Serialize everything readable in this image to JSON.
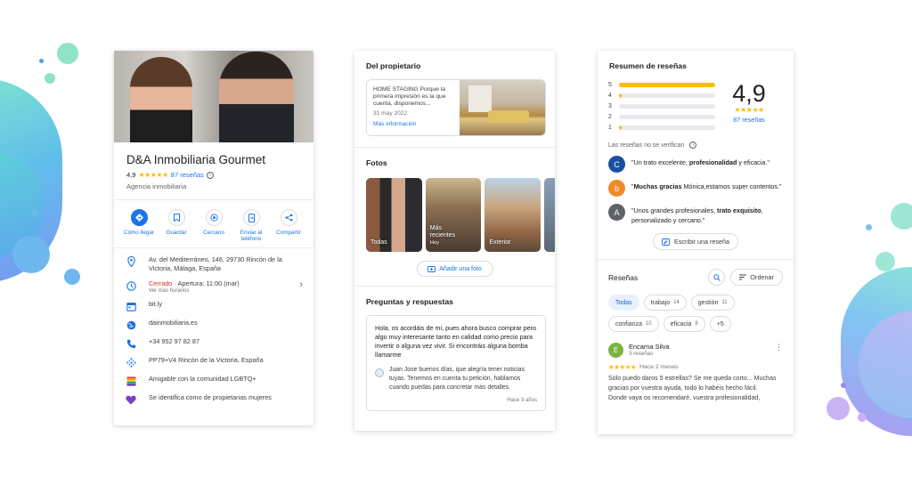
{
  "colors": {
    "accent": "#1a73e8",
    "star": "#fbbc04",
    "closed": "#d93025"
  },
  "profile": {
    "name": "D&A Inmobiliaria Gourmet",
    "rating": "4,9",
    "stars": "★★★★★",
    "reviews_link": "87 reseñas",
    "category": "Agencia inmobiliaria",
    "actions": [
      {
        "label": "Cómo llegar",
        "icon": "directions-icon"
      },
      {
        "label": "Guardar",
        "icon": "bookmark-icon"
      },
      {
        "label": "Cercano",
        "icon": "nearby-icon"
      },
      {
        "label": "Enviar al teléfono",
        "icon": "send-to-phone-icon"
      },
      {
        "label": "Compartir",
        "icon": "share-icon"
      }
    ],
    "address": "Av. del Mediterráneo, 146, 29730 Rincón de la Victoria, Málaga, España",
    "hours_status": "Cerrado",
    "hours_open": " · Apertura: 11:00 (mar)",
    "hours_more": "Ver más horarios",
    "menu_link": "bit.ly",
    "website": "dainmobiliaria.es",
    "phone": "+34 952 97 82 87",
    "plus_code": "PP79+V4 Rincón de la Victoria, España",
    "lgbtq": "Amigable con la comunidad LGBTQ+",
    "women_owned": "Se identifica como de propietarias mujeres"
  },
  "owner": {
    "title": "Del propietario",
    "post_text": "HOME STAGING Porque la primera impresión es la que cuenta, disponemos...",
    "post_date": "31 may 2022",
    "post_more": "Más información"
  },
  "photos": {
    "title": "Fotos",
    "items": [
      {
        "label": "Todas",
        "sub": ""
      },
      {
        "label": "Más recientes",
        "sub": "Hoy"
      },
      {
        "label": "Exterior",
        "sub": ""
      }
    ],
    "add_label": "Añadir una foto"
  },
  "qa": {
    "title": "Preguntas y respuestas",
    "question": "Hola, os acordáis de mi, pues ahora busco comprar pero algo muy interesante tanto en calidad como precio para invertir o alguna vez vivir. Si encontráis alguna bomba llamarme",
    "answer": "Juan Jose buenos días, que alegría tener noticias tuyas. Tenemos en cuenta tu petición, hablamos cuando puedas para concretar más detalles.",
    "time": "Hace 3 años"
  },
  "summary": {
    "title": "Resumen de reseñas",
    "distribution": [
      {
        "star": "5",
        "fraction": 1.0
      },
      {
        "star": "4",
        "fraction": 0.03
      },
      {
        "star": "3",
        "fraction": 0.0
      },
      {
        "star": "2",
        "fraction": 0.0
      },
      {
        "star": "1",
        "fraction": 0.03
      }
    ],
    "score": "4,9",
    "stars": "★★★★★",
    "count": "87 reseñas",
    "not_verified": "Las reseñas no se verifican",
    "quotes": [
      {
        "initial": "C",
        "color": "#1a4fa0",
        "pre": "\"Un trato excelente, ",
        "bold": "profesionalidad",
        "post": " y eficacia.\""
      },
      {
        "initial": "b",
        "color": "#ef8a2b",
        "pre": "\"",
        "bold": "Muchas gracias",
        "post": " Mónica,estamos super contentos.\""
      },
      {
        "initial": "A",
        "color": "#5f6368",
        "pre": "\"Unos grandes profesionales, ",
        "bold": "trato exquisito",
        "post": ", personalizado y cercano.\""
      }
    ],
    "write_review": "Escribir una reseña"
  },
  "reviews": {
    "title": "Reseñas",
    "sort_label": "Ordenar",
    "chips": [
      {
        "label": "Todas",
        "count": ""
      },
      {
        "label": "trabajo",
        "count": "14"
      },
      {
        "label": "gestión",
        "count": "11"
      },
      {
        "label": "confianza",
        "count": "10"
      },
      {
        "label": "eficacia",
        "count": "8"
      },
      {
        "label": "+5",
        "count": ""
      }
    ],
    "first": {
      "initial": "E",
      "name": "Encarna Silva",
      "sub": "3 reseñas",
      "stars": "★★★★★",
      "time": "Hace 2 meses",
      "text": "Sólo puedo daros 5 estrellas? Se me queda corto... Muchas gracias por vuestra ayuda, todo lo habéis hecho fácil.",
      "text2": "Donde vaya os recomendaré, vuestra profesionalidad,"
    }
  }
}
